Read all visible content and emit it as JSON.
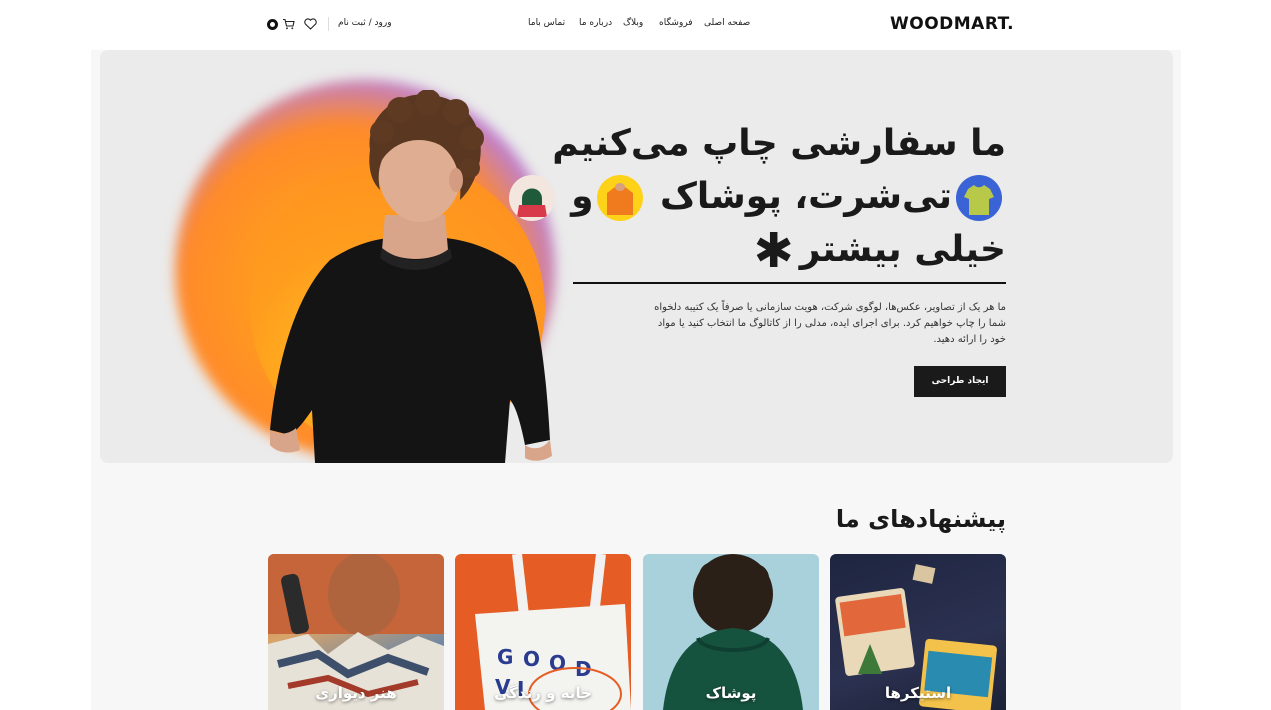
{
  "header": {
    "logo": "WOODMART.",
    "nav": [
      "صفحه اصلی",
      "فروشگاه",
      "وبلاگ",
      "درباره ما",
      "تماس باما"
    ],
    "account_label": "ورود / ثبت نام",
    "icons": [
      "heart-icon",
      "cart-icon"
    ]
  },
  "hero": {
    "title_line1": "ما سفارشی چاپ می‌کنیم",
    "title_line2_a": "تی‌شرت، پوشاک",
    "title_line2_b": "و",
    "title_line3": "خیلی بیشتر",
    "description": "ما هر یک از تصاویر، عکس‌ها، لوگوی شرکت، هویت سازمانی یا صرفاً یک کتیبه دلخواه شما را چاپ خواهیم کرد. برای اجرای ایده، مدلی را از کاتالوگ ما انتخاب کنید یا مواد خود را ارائه دهید.",
    "cta_label": "ایجاد طراحی"
  },
  "offers": {
    "title": "پیشنهادهای ما",
    "cards": [
      {
        "label": "استیکرها"
      },
      {
        "label": "پوشاک"
      },
      {
        "label": "خانه و زندگی"
      },
      {
        "label": "هنر دیواری"
      }
    ]
  },
  "colors": {
    "accent_dark": "#1a1a1a",
    "hero_bg": "#ebebeb",
    "orange": "#ff9a1f",
    "purple": "#b27ce8"
  }
}
